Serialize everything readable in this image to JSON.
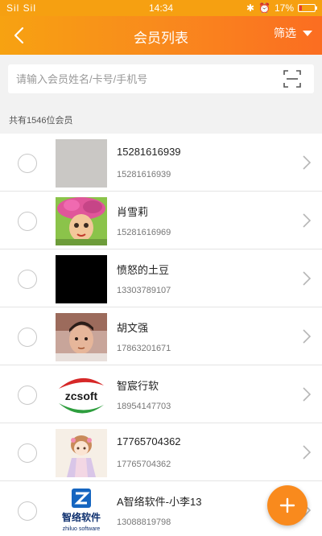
{
  "status_bar": {
    "signal": "Sil Sil",
    "time": "14:34",
    "battery_text": "17%",
    "battery_level": 0.17,
    "icons": [
      "signal-icon",
      "wifi-icon",
      "bluetooth-icon",
      "alarm-icon",
      "battery-icon"
    ]
  },
  "header": {
    "title": "会员列表",
    "filter_label": "筛选",
    "back_icon": "back-arrow-icon",
    "filter_icon": "triangle-down-icon"
  },
  "search": {
    "placeholder": "请输入会员姓名/卡号/手机号",
    "value": "",
    "scan_icon": "scan-icon"
  },
  "summary": {
    "member_count_text": "共有1546位会员"
  },
  "members": [
    {
      "name": "15281616939",
      "phone": "15281616939",
      "avatar": "blank-gray-avatar"
    },
    {
      "name": "肖雪莉",
      "phone": "15281616969",
      "avatar": "painted-portrait-avatar"
    },
    {
      "name": "愤怒的土豆",
      "phone": "13303789107",
      "avatar": "black-avatar"
    },
    {
      "name": "胡文强",
      "phone": "17863201671",
      "avatar": "selfie-avatar"
    },
    {
      "name": "智宸行软",
      "phone": "18954147703",
      "avatar": "zcsoft-logo-avatar"
    },
    {
      "name": "17765704362",
      "phone": "17765704362",
      "avatar": "anime-girl-avatar"
    },
    {
      "name": "A智络软件-小李13",
      "phone": "13088819798",
      "avatar": "zhiluo-logo-avatar"
    }
  ],
  "avatar_logos": {
    "zcsoft": "zcsoft",
    "zhiluo_cn": "智络软件",
    "zhiluo_en": "zhiluo software"
  },
  "fab": {
    "icon": "plus-icon"
  },
  "colors": {
    "primary_orange": "#f98a1d",
    "gradient_start": "#f7a211",
    "gradient_end": "#fb6d21",
    "background": "#f2f2f2"
  }
}
